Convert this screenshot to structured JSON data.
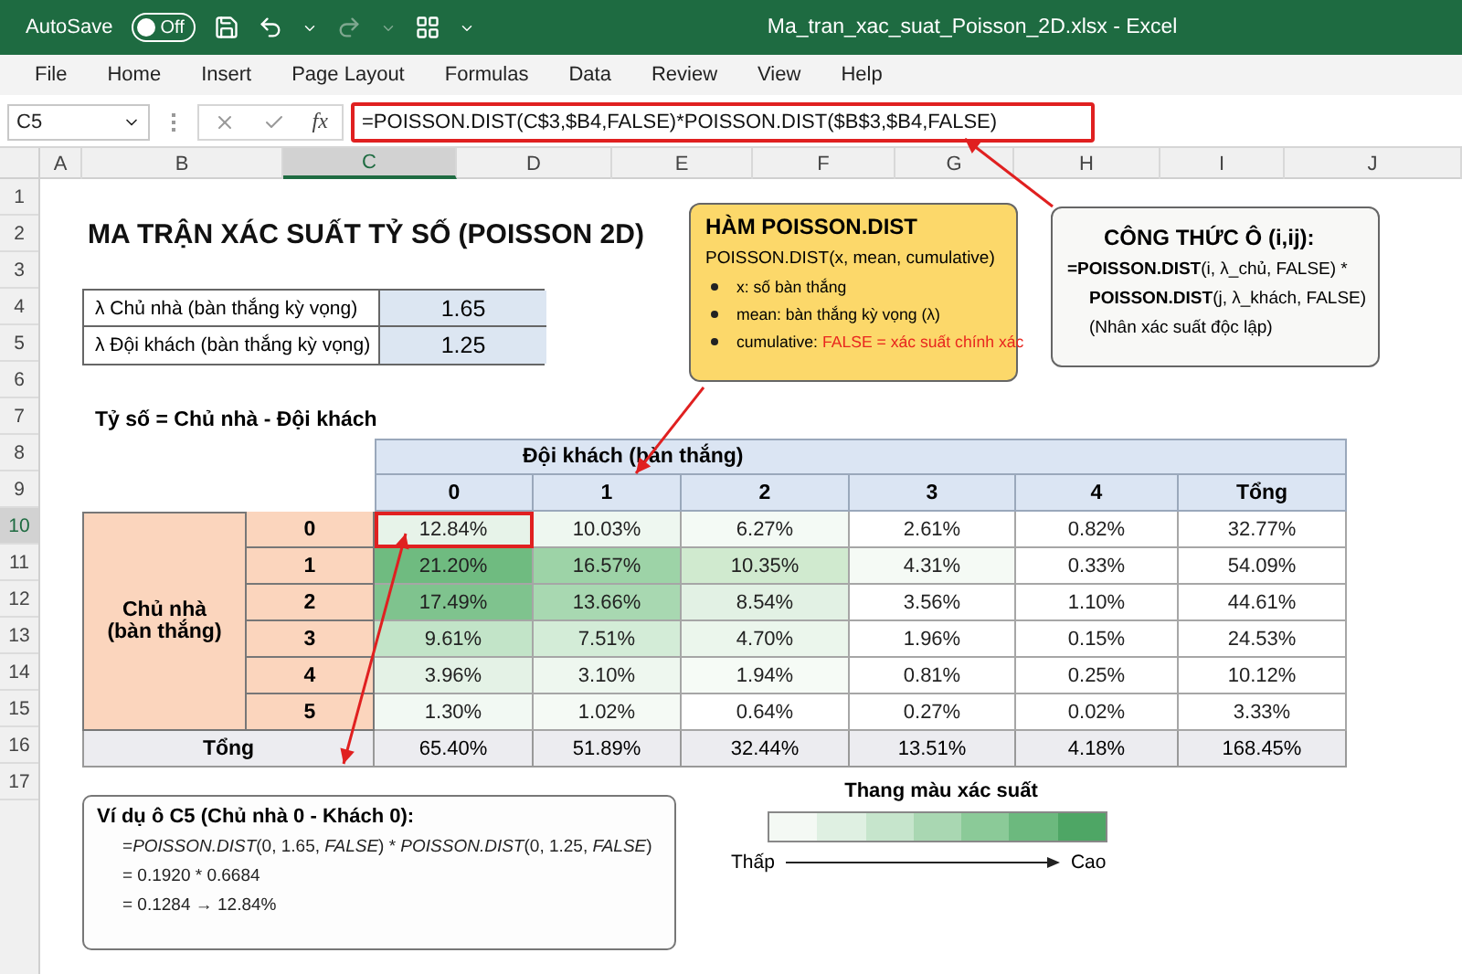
{
  "window": {
    "title": "Ma_tran_xac_suat_Poisson_2D.xlsx  -  Excel"
  },
  "autosave": {
    "label": "AutoSave",
    "state": "Off",
    "on": false
  },
  "menu": [
    {
      "label": "File",
      "selected": false
    },
    {
      "label": "Home",
      "selected": false
    },
    {
      "label": "Insert",
      "selected": false
    },
    {
      "label": "Page Layout",
      "selected": false
    },
    {
      "label": "Formulas",
      "selected": false
    },
    {
      "label": "Data",
      "selected": false
    },
    {
      "label": "Review",
      "selected": false
    },
    {
      "label": "View",
      "selected": false
    },
    {
      "label": "Help",
      "selected": false
    }
  ],
  "formula_bar": {
    "cell_ref": "C5",
    "fx": "fx",
    "formula": "=POISSON.DIST(C$3,$B4,FALSE)*POISSON.DIST($B$3,$B4,FALSE)"
  },
  "column_headers": [
    {
      "label": "A",
      "selected": false
    },
    {
      "label": "B",
      "selected": false
    },
    {
      "label": "C",
      "selected": true
    },
    {
      "label": "D",
      "selected": false
    },
    {
      "label": "E",
      "selected": false
    },
    {
      "label": "F",
      "selected": false
    },
    {
      "label": "G",
      "selected": false
    },
    {
      "label": "H",
      "selected": false
    },
    {
      "label": "I",
      "selected": false
    },
    {
      "label": "J",
      "selected": false
    }
  ],
  "row_numbers": [
    {
      "label": "1",
      "selected": false
    },
    {
      "label": "2",
      "selected": false
    },
    {
      "label": "3",
      "selected": false
    },
    {
      "label": "4",
      "selected": false
    },
    {
      "label": "5",
      "selected": false
    },
    {
      "label": "6",
      "selected": false
    },
    {
      "label": "7",
      "selected": false
    },
    {
      "label": "8",
      "selected": false
    },
    {
      "label": "9",
      "selected": false
    },
    {
      "label": "10",
      "selected": true
    },
    {
      "label": "11",
      "selected": false
    },
    {
      "label": "12",
      "selected": false
    },
    {
      "label": "13",
      "selected": false
    },
    {
      "label": "14",
      "selected": false
    },
    {
      "label": "15",
      "selected": false
    },
    {
      "label": "16",
      "selected": false
    },
    {
      "label": "17",
      "selected": false
    }
  ],
  "sheet": {
    "title": "MA TRẬN XÁC SUẤT TỶ SỐ (POISSON 2D)",
    "params": [
      {
        "label": "λ  Chủ nhà (bàn thắng kỳ vọng)",
        "value": "1.65"
      },
      {
        "label": "λ  Đội khách (bàn thắng kỳ vọng)",
        "value": "1.25"
      }
    ],
    "score_label": "Tỷ số =  Chủ nhà -  Đội khách",
    "matrix": {
      "col_group": "Đội khách (bàn thắng)",
      "row_group": "Chủ nhà (bàn thắng)",
      "columns": [
        "0",
        "1",
        "2",
        "3",
        "4",
        "Tổng"
      ],
      "rows": [
        {
          "label": "0",
          "cells": [
            {
              "text": "12.84%",
              "color": "#e7f3e9",
              "highlighted": true
            },
            {
              "text": "10.03%",
              "color": "#eef7f0"
            },
            {
              "text": "6.27%",
              "color": "#f4faf5"
            },
            {
              "text": "2.61%"
            },
            {
              "text": "0.82%"
            },
            {
              "text": "32.77%"
            }
          ]
        },
        {
          "label": "1",
          "cells": [
            {
              "text": "21.20%",
              "color": "#6fbb80"
            },
            {
              "text": "16.57%",
              "color": "#9dd3a7"
            },
            {
              "text": "10.35%",
              "color": "#d0eacf"
            },
            {
              "text": "4.31%",
              "color": "#f5faf5"
            },
            {
              "text": "0.33%"
            },
            {
              "text": "54.09%"
            }
          ]
        },
        {
          "label": "2",
          "cells": [
            {
              "text": "17.49%",
              "color": "#7fc38e"
            },
            {
              "text": "13.66%",
              "color": "#a8d8b1"
            },
            {
              "text": "8.54%",
              "color": "#e2f1e4"
            },
            {
              "text": "3.56%"
            },
            {
              "text": "1.10%"
            },
            {
              "text": "44.61%"
            }
          ]
        },
        {
          "label": "3",
          "cells": [
            {
              "text": "9.61%",
              "color": "#c2e4c8"
            },
            {
              "text": "7.51%",
              "color": "#d3ecd7"
            },
            {
              "text": "4.70%",
              "color": "#ebf6ec"
            },
            {
              "text": "1.96%"
            },
            {
              "text": "0.15%"
            },
            {
              "text": "24.53%"
            }
          ]
        },
        {
          "label": "4",
          "cells": [
            {
              "text": "3.96%",
              "color": "#e4f2e6"
            },
            {
              "text": "3.10%",
              "color": "#eef7ef"
            },
            {
              "text": "1.94%",
              "color": "#f6fbf6"
            },
            {
              "text": "0.81%"
            },
            {
              "text": "0.25%"
            },
            {
              "text": "10.12%"
            }
          ]
        },
        {
          "label": "5",
          "cells": [
            {
              "text": "1.30%",
              "color": "#f2f9f3"
            },
            {
              "text": "1.02%",
              "color": "#f5faf5"
            },
            {
              "text": "0.64%"
            },
            {
              "text": "0.27%"
            },
            {
              "text": "0.02%"
            },
            {
              "text": "3.33%"
            }
          ]
        }
      ],
      "total": {
        "label": "Tổng",
        "cells": [
          "65.40%",
          "51.89%",
          "32.44%",
          "13.51%",
          "4.18%",
          "168.45%"
        ]
      }
    },
    "example": {
      "title": "Ví dụ ô C5 (Chủ nhà 0 - Khách 0):",
      "lines": [
        [
          {
            "text": "=",
            "kind": "plain"
          },
          {
            "text": "POISSON.DIST",
            "kind": "italic"
          },
          {
            "text": "(0, 1.65, ",
            "kind": "plain"
          },
          {
            "text": "FALSE",
            "kind": "italic"
          },
          {
            "text": ") * ",
            "kind": "plain"
          },
          {
            "text": "POISSON.DIST",
            "kind": "italic"
          },
          {
            "text": "(0, 1.25, ",
            "kind": "plain"
          },
          {
            "text": "FALSE",
            "kind": "italic"
          },
          {
            "text": ")",
            "kind": "plain"
          }
        ],
        [
          {
            "text": "= 0.1920 * 0.6684",
            "kind": "plain"
          }
        ],
        [
          {
            "text": "= 0.1284  →  12.84%",
            "kind": "plain"
          }
        ]
      ]
    },
    "legend": {
      "title": "Thang màu xác suất",
      "swatches": [
        {
          "color": "#f4f9f4"
        },
        {
          "color": "#dff0e2"
        },
        {
          "color": "#c6e5cc"
        },
        {
          "color": "#a9d7b2"
        },
        {
          "color": "#8bca98"
        },
        {
          "color": "#6cb97e"
        },
        {
          "color": "#4ea665"
        }
      ],
      "low": "Thấp",
      "high": "Cao"
    }
  },
  "callouts": [
    {
      "kind": "note",
      "title": "HÀM POISSON.DIST",
      "lines": [
        [
          {
            "text": "POISSON.DIST(x, mean, cumulative)",
            "kind": "plain"
          }
        ]
      ],
      "bullets": [
        [
          {
            "text": "x: số bàn thắng",
            "kind": "plain"
          }
        ],
        [
          {
            "text": "mean: bàn thắng kỳ vọng (λ)",
            "kind": "plain"
          }
        ],
        [
          {
            "text": "cumulative: ",
            "kind": "plain"
          },
          {
            "text": "FALSE = xác suất chính xác",
            "kind": "red"
          }
        ]
      ]
    },
    {
      "kind": "formula",
      "title": "CÔNG THỨC Ô (i,ij):",
      "lines": [
        [
          {
            "text": "=POISSON.DIST",
            "kind": "bold"
          },
          {
            "text": "(i, λ_chủ, FALSE) *",
            "kind": "plain"
          }
        ],
        [
          {
            "text": "POISSON.DIST",
            "kind": "bold"
          },
          {
            "text": "(j, λ_khách, FALSE)",
            "kind": "plain"
          }
        ],
        [
          {
            "text": "(Nhân xác suất độc lập)",
            "kind": "plain"
          }
        ]
      ]
    }
  ]
}
